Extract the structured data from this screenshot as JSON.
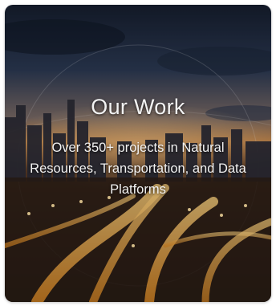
{
  "card": {
    "title": "Our Work",
    "description": "Over 350+ projects in Natural Resources, Transportation, and Data Platforms",
    "background_icon": "city-highway-night-image"
  },
  "colors": {
    "text": "#f2f2f2",
    "sky_top": "#1c2838",
    "horizon": "#c9803a",
    "road_light": "#ffb347"
  }
}
